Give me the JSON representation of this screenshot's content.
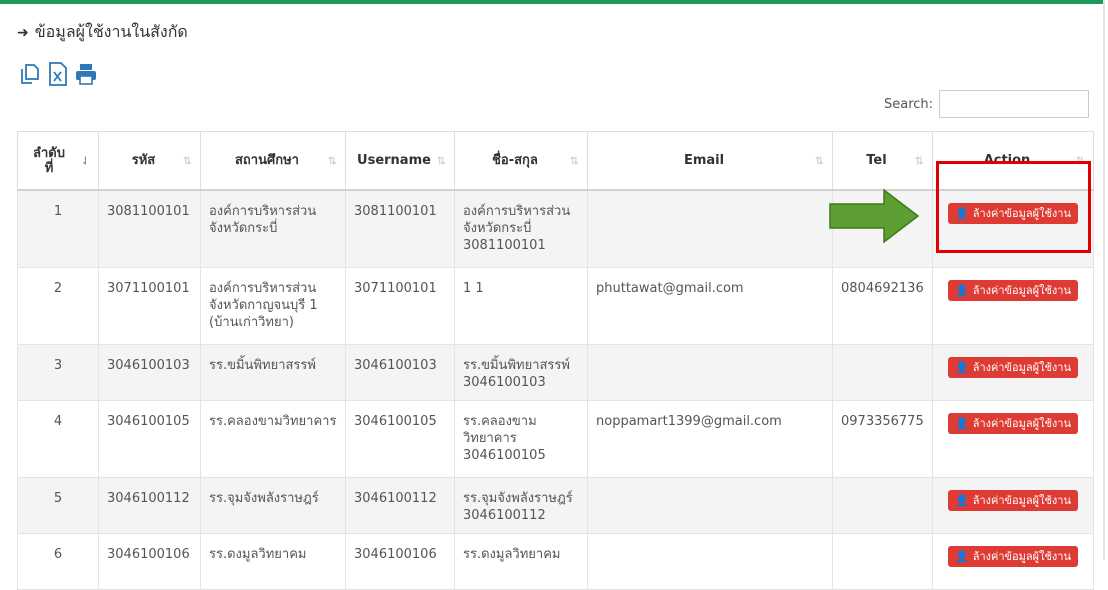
{
  "panel": {
    "title": "ข้อมูลผู้ใช้งานในสังกัด",
    "title_icon": "sign-in-icon"
  },
  "toolbar": {
    "icons": [
      "copy-icon",
      "excel-icon",
      "print-icon"
    ]
  },
  "search": {
    "label": "Search:",
    "value": ""
  },
  "table": {
    "headers": {
      "order": "ลำดับที่",
      "code": "รหัส",
      "school": "สถานศึกษา",
      "username": "Username",
      "fullname": "ชื่อ-สกุล",
      "email": "Email",
      "tel": "Tel",
      "action": "Action"
    },
    "action_label": "ล้างค่าข้อมูลผู้ใช้งาน",
    "rows": [
      {
        "order": "1",
        "code": "3081100101",
        "school": "องค์การบริหารส่วนจังหวัดกระบี่",
        "username": "3081100101",
        "fullname": "องค์การบริหารส่วนจังหวัดกระบี่ 3081100101",
        "email": "",
        "tel": ""
      },
      {
        "order": "2",
        "code": "3071100101",
        "school": "องค์การบริหารส่วนจังหวัดกาญจนบุรี 1 (บ้านเก่าวิทยา)",
        "username": "3071100101",
        "fullname": "1 1",
        "email": "phuttawat@gmail.com",
        "tel": "0804692136"
      },
      {
        "order": "3",
        "code": "3046100103",
        "school": "รร.ขมิ้นพิทยาสรรพ์",
        "username": "3046100103",
        "fullname": "รร.ขมิ้นพิทยาสรรพ์ 3046100103",
        "email": "",
        "tel": ""
      },
      {
        "order": "4",
        "code": "3046100105",
        "school": "รร.คลองขามวิทยาคาร",
        "username": "3046100105",
        "fullname": "รร.คลองขามวิทยาคาร 3046100105",
        "email": "noppamart1399@gmail.com",
        "tel": "0973356775"
      },
      {
        "order": "5",
        "code": "3046100112",
        "school": "รร.จุมจังพลังราษฎร์",
        "username": "3046100112",
        "fullname": "รร.จุมจังพลังราษฎร์ 3046100112",
        "email": "",
        "tel": ""
      },
      {
        "order": "6",
        "code": "3046100106",
        "school": "รร.ดงมูลวิทยาคม",
        "username": "3046100106",
        "fullname": "รร.ดงมูลวิทยาคม",
        "email": "",
        "tel": ""
      }
    ]
  },
  "colors": {
    "accent": "#1c9a5a",
    "button": "#dd3b34",
    "highlight_box": "#e00000",
    "arrow": "#5c9e31"
  }
}
